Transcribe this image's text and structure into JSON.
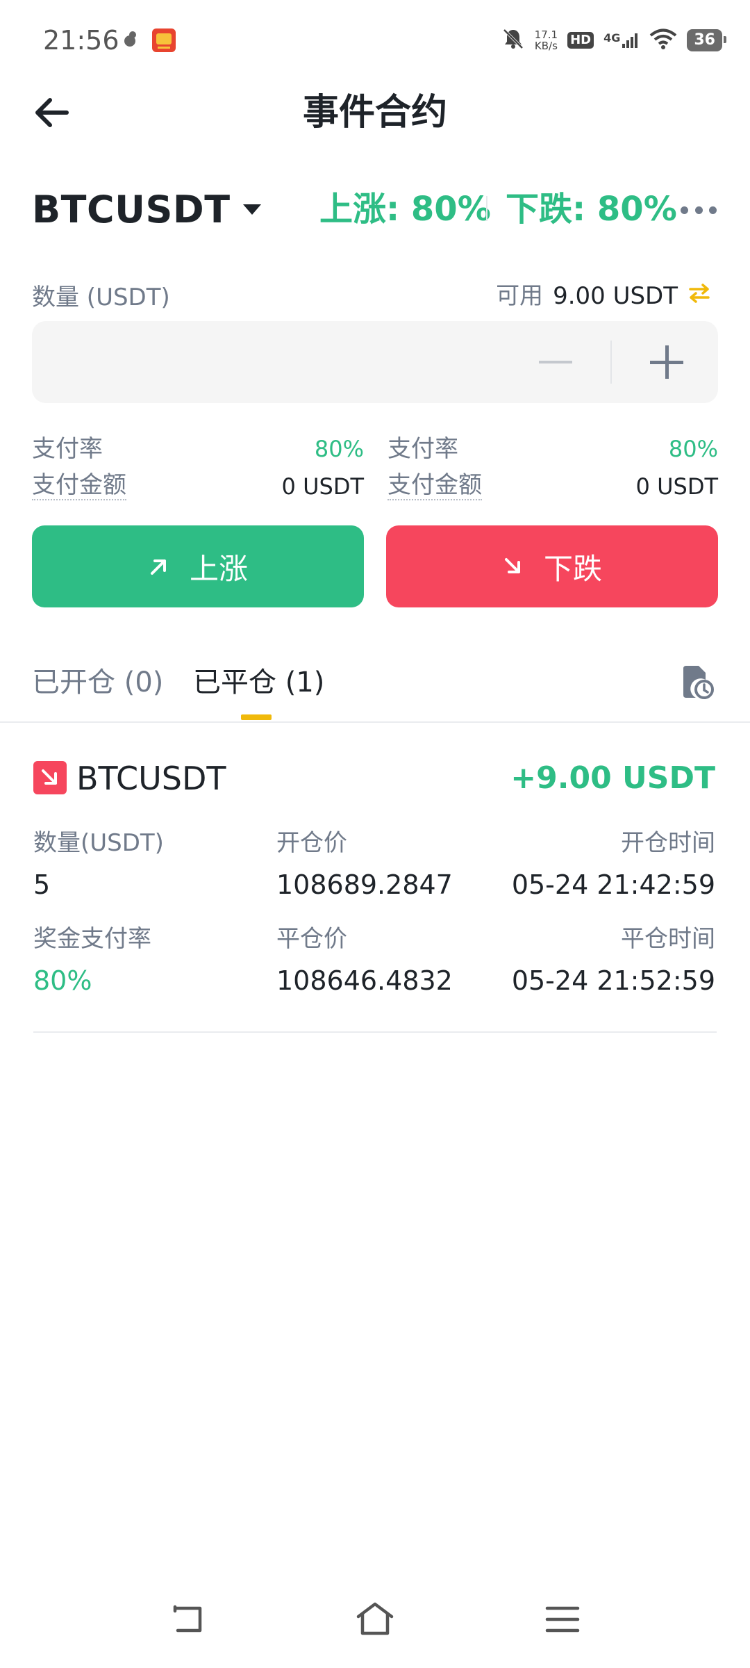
{
  "status_bar": {
    "time": "21:56",
    "net_speed_value": "17.1",
    "net_speed_unit": "KB/s",
    "hd": "HD",
    "network": "4G",
    "battery": "36",
    "left_icons": [
      "fan-icon",
      "taobao-app-icon"
    ],
    "right_icons": [
      "mute-bell-icon",
      "signal-icon",
      "wifi-icon",
      "battery-icon"
    ]
  },
  "header": {
    "title": "事件合约"
  },
  "pair": {
    "name": "BTCUSDT",
    "up_rate": "上涨: 80%",
    "down_rate": "下跌: 80%"
  },
  "quantity": {
    "label": "数量 (USDT)",
    "available_label": "可用",
    "available_value": "9.00 USDT",
    "value": ""
  },
  "payout": {
    "up": {
      "rate_label": "支付率",
      "rate_value": "80%",
      "amount_label": "支付金额",
      "amount_value": "0 USDT"
    },
    "down": {
      "rate_label": "支付率",
      "rate_value": "80%",
      "amount_label": "支付金额",
      "amount_value": "0 USDT"
    }
  },
  "actions": {
    "up_label": "上涨",
    "down_label": "下跌"
  },
  "tabs": {
    "open": "已开仓 (0)",
    "closed": "已平仓 (1)",
    "active": "closed"
  },
  "position": {
    "direction": "down",
    "symbol": "BTCUSDT",
    "pnl": "+9.00 USDT",
    "qty_label": "数量(USDT)",
    "qty_value": "5",
    "open_price_label": "开仓价",
    "open_price_value": "108689.2847",
    "open_time_label": "开仓时间",
    "open_time_value": "05-24 21:42:59",
    "payout_rate_label": "奖金支付率",
    "payout_rate_value": "80%",
    "close_price_label": "平仓价",
    "close_price_value": "108646.4832",
    "close_time_label": "平仓时间",
    "close_time_value": "05-24 21:52:59"
  },
  "colors": {
    "up": "#2ebd85",
    "down": "#f6465d",
    "accent": "#f0b90b",
    "text_primary": "#1e2329",
    "text_secondary": "#707a8a"
  }
}
